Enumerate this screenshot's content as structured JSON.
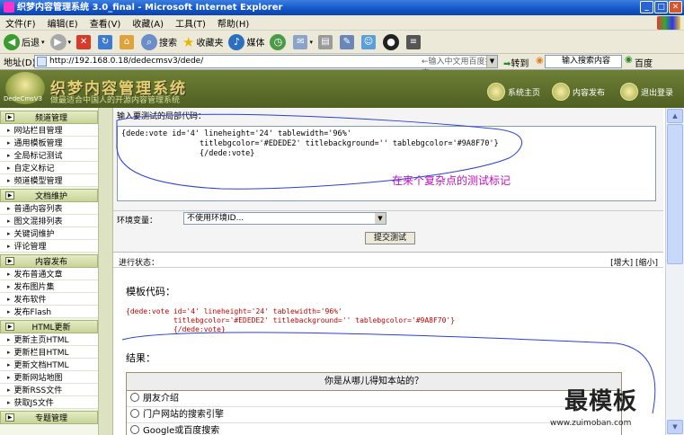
{
  "window": {
    "title": "统 3.0_final - Microsoft Internet Explorer",
    "title_prefix": "织梦内容管理系"
  },
  "menu": [
    "文件(F)",
    "编辑(E)",
    "查看(V)",
    "收藏(A)",
    "工具(T)",
    "帮助(H)"
  ],
  "toolbar": {
    "back": "后退",
    "search": "搜索",
    "favorites": "收藏夹",
    "media": "媒体"
  },
  "address": {
    "label": "地址(D)",
    "url": "http://192.168.0.18/dedecmsv3/dede/",
    "hint": "←输入中文用百度搜索",
    "go": "转到",
    "search_box": "输入搜索内容",
    "baidu": "百度"
  },
  "header": {
    "logo_text": "DedeCmsV3",
    "system_name": "织梦内容管理系统",
    "slogan": "做最适合中国人的开源内容管理系统",
    "links": [
      "系统主页",
      "内容发布",
      "退出登录"
    ]
  },
  "sidebar": {
    "groups": [
      {
        "label": "频道管理",
        "items": [
          "网站栏目管理",
          "通用模板管理",
          "全局标记测试",
          "自定义标记",
          "频道模型管理"
        ]
      },
      {
        "label": "文档维护",
        "items": [
          "普通内容列表",
          "图文混排列表",
          "关键词维护",
          "评论管理"
        ]
      },
      {
        "label": "内容发布",
        "items": [
          "发布普通文章",
          "发布图片集",
          "发布软件",
          "发布Flash"
        ]
      },
      {
        "label": "HTML更新",
        "items": [
          "更新主页HTML",
          "更新栏目HTML",
          "更新文档HTML",
          "更新网站地图",
          "更新RSS文件",
          "获取JS文件"
        ]
      },
      {
        "label": "专题管理",
        "items": []
      }
    ]
  },
  "main": {
    "code_label": "输入要测试的局部代码：",
    "code": "{dede:vote id='4' lineheight='24' tablewidth='96%'\n                 titlebgcolor='#EDEDE2' titlebackground='' tablebgcolor='#9A8F70'}\n                 {/dede:vote}",
    "annotation": "在来个复杂点的测试标记",
    "env_label": "环境变量：",
    "env_value": "不使用环境ID...",
    "submit": "提交测试",
    "status_label": "进行状态：",
    "size_buttons": "[增大] [缩小]",
    "template_caption": "模板代码：",
    "template_code": "{dede:vote id='4' lineheight='24' tablewidth='96%'\n           titlebgcolor='#EDEDE2' titlebackground='' tablebgcolor='#9A8F70'}\n           {/dede:vote}",
    "result_caption": "结果：",
    "vote": {
      "question": "你是从哪儿得知本站的？",
      "options": [
        "朋友介绍",
        "门户网站的搜索引擎",
        "Google或百度搜索"
      ]
    }
  },
  "watermark": {
    "text": "最模板",
    "url": "www.zuimoban.com"
  }
}
